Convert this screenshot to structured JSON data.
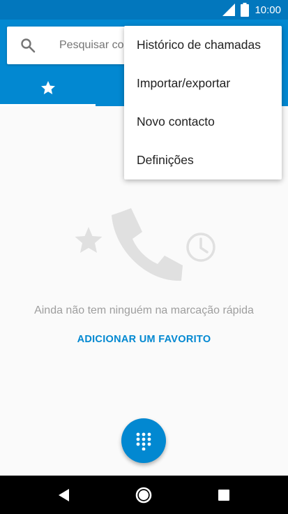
{
  "status_bar": {
    "time": "10:00",
    "icons": [
      "signal-icon",
      "battery-icon"
    ]
  },
  "search": {
    "placeholder": "Pesquisar co"
  },
  "tabs": [
    {
      "icon": "star-icon",
      "selected": true
    },
    {
      "icon": "clock-icon",
      "selected": false
    },
    {
      "icon": "people-icon",
      "selected": false
    }
  ],
  "menu": {
    "items": [
      {
        "label": "Histórico de chamadas"
      },
      {
        "label": "Importar/exportar"
      },
      {
        "label": "Novo contacto"
      },
      {
        "label": "Definições"
      }
    ]
  },
  "empty_state": {
    "message": "Ainda não tem ninguém na marcação rápida",
    "action_label": "ADICIONAR UM FAVORITO"
  },
  "fab": {
    "icon": "dialpad-icon"
  },
  "nav_bar": {
    "icons": [
      "back-icon",
      "home-icon",
      "recents-icon"
    ]
  },
  "colors": {
    "primary": "#0288d1",
    "primary_dark": "#0277bd",
    "background": "#fafafa"
  }
}
